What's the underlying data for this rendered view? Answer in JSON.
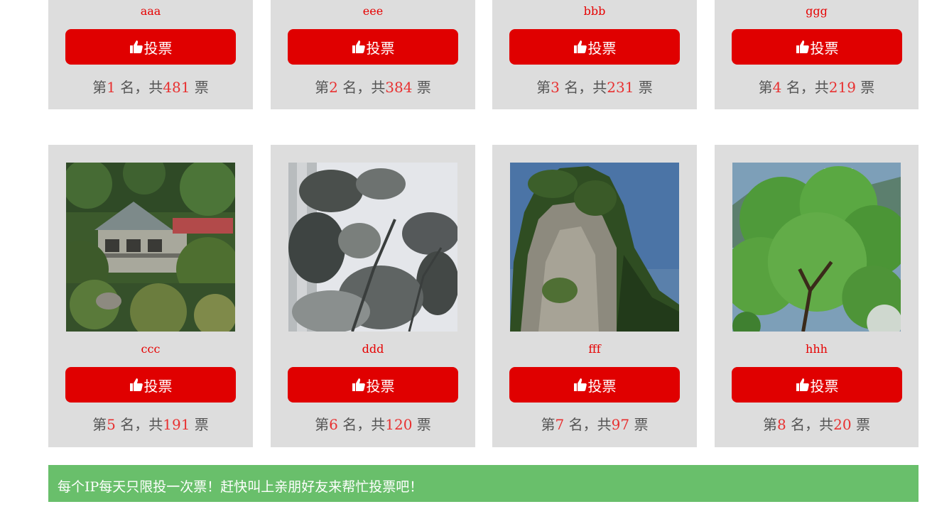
{
  "items": [
    {
      "name": "aaa",
      "vote_label": "投票",
      "rank_prefix": "第",
      "rank": "1",
      "rank_mid": " 名，共",
      "votes": "481",
      "rank_suffix": " 票"
    },
    {
      "name": "eee",
      "vote_label": "投票",
      "rank_prefix": "第",
      "rank": "2",
      "rank_mid": " 名，共",
      "votes": "384",
      "rank_suffix": " 票"
    },
    {
      "name": "bbb",
      "vote_label": "投票",
      "rank_prefix": "第",
      "rank": "3",
      "rank_mid": " 名，共",
      "votes": "231",
      "rank_suffix": " 票"
    },
    {
      "name": "ggg",
      "vote_label": "投票",
      "rank_prefix": "第",
      "rank": "4",
      "rank_mid": " 名，共",
      "votes": "219",
      "rank_suffix": " 票"
    },
    {
      "name": "ccc",
      "vote_label": "投票",
      "rank_prefix": "第",
      "rank": "5",
      "rank_mid": " 名，共",
      "votes": "191",
      "rank_suffix": " 票"
    },
    {
      "name": "ddd",
      "vote_label": "投票",
      "rank_prefix": "第",
      "rank": "6",
      "rank_mid": " 名，共",
      "votes": "120",
      "rank_suffix": " 票"
    },
    {
      "name": "fff",
      "vote_label": "投票",
      "rank_prefix": "第",
      "rank": "7",
      "rank_mid": " 名，共",
      "votes": "97",
      "rank_suffix": " 票"
    },
    {
      "name": "hhh",
      "vote_label": "投票",
      "rank_prefix": "第",
      "rank": "8",
      "rank_mid": " 名，共",
      "votes": "20",
      "rank_suffix": " 票"
    }
  ],
  "notice": "每个IP每天只限投一次票！赶快叫上亲朋好友来帮忙投票吧！",
  "colors": {
    "button": "#e00000",
    "name": "#e60000",
    "highlight": "#e83030",
    "card": "#dddddd",
    "notice": "#69bf6b"
  }
}
